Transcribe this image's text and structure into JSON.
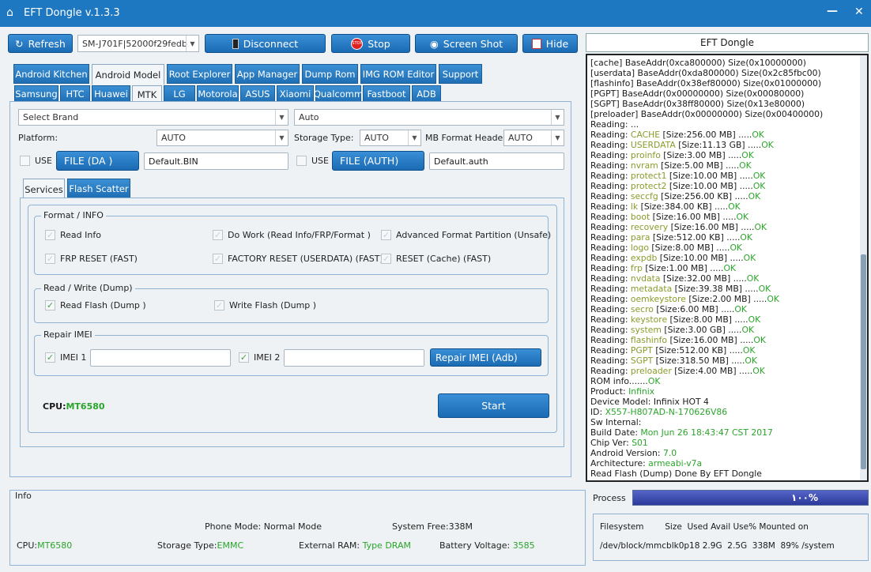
{
  "window": {
    "title": "EFT Dongle  v.1.3.3"
  },
  "toolbar": {
    "refresh": "Refresh",
    "device": "SM-J701F|52000f29fedb",
    "disconnect": "Disconnect",
    "stop": "Stop",
    "screenshot": "Screen Shot",
    "hide": "Hide"
  },
  "tabs_top": [
    "Android Kitchen",
    "Android Model",
    "Root Explorer",
    "App Manager",
    "Dump Rom",
    "IMG ROM Editor",
    "Support"
  ],
  "tabs_brand": [
    "Samsung",
    "HTC",
    "Huawei",
    "MTK",
    "LG",
    "Motorola",
    "ASUS",
    "Xiaomi",
    "Qualcomm",
    "Fastboot",
    "ADB"
  ],
  "form": {
    "brand": "Select Brand",
    "auto": "Auto",
    "platform_label": "Platform:",
    "platform": "AUTO",
    "storage_label": "Storage Type:",
    "storage": "AUTO",
    "mb_label": "MB Format Header",
    "mb": "AUTO",
    "use": "USE",
    "file_da": "FILE (DA )",
    "da_value": "Default.BIN",
    "file_auth": "FILE (AUTH)",
    "auth_value": "Default.auth"
  },
  "subtabs": [
    "Services",
    "Flash Scatter"
  ],
  "format_group": {
    "title": "Format / INFO",
    "read_info": "Read Info",
    "do_work": "Do Work (Read Info/FRP/Format )",
    "adv_format": "Advanced Format Partition (Unsafe)",
    "frp_reset": "FRP RESET (FAST)",
    "factory_reset": "FACTORY RESET (USERDATA) (FAST)",
    "reset_cache": "RESET (Cache) (FAST)"
  },
  "rw_group": {
    "title": "Read / Write (Dump)",
    "read_flash": "Read Flash (Dump )",
    "write_flash": "Write Flash (Dump )"
  },
  "imei_group": {
    "title": "Repair IMEI",
    "imei1": "IMEI 1",
    "imei2": "IMEI 2",
    "repair": "Repair IMEI (Adb)"
  },
  "cpu": {
    "label": "CPU:",
    "value": "MT6580"
  },
  "start": "Start",
  "log_title": "EFT Dongle",
  "log": [
    [
      [
        "[cache] BaseAddr(0xca800000) Size(0x10000000)",
        ""
      ]
    ],
    [
      [
        "[userdata] BaseAddr(0xda800000) Size(0x2c85fbc00)",
        ""
      ]
    ],
    [
      [
        "[flashinfo] BaseAddr(0x38ef80000) Size(0x01000000)",
        ""
      ]
    ],
    [
      [
        "[PGPT] BaseAddr(0x00000000) Size(0x00080000)",
        ""
      ]
    ],
    [
      [
        "[SGPT] BaseAddr(0x38ff80000) Size(0x13e80000)",
        ""
      ]
    ],
    [
      [
        "[preloader] BaseAddr(0x00000000) Size(0x00400000)",
        ""
      ]
    ],
    [
      [
        "Reading: ...",
        ""
      ]
    ],
    [
      [
        "Reading: ",
        ""
      ],
      [
        "CACHE",
        "y"
      ],
      [
        " [Size:256.00 MB] .....",
        ""
      ],
      [
        "OK",
        "g"
      ]
    ],
    [
      [
        "Reading: ",
        ""
      ],
      [
        "USERDATA",
        "y"
      ],
      [
        " [Size:11.13 GB] .....",
        ""
      ],
      [
        "OK",
        "g"
      ]
    ],
    [
      [
        "Reading: ",
        ""
      ],
      [
        "proinfo",
        "y"
      ],
      [
        " [Size:3.00 MB] .....",
        ""
      ],
      [
        "OK",
        "g"
      ]
    ],
    [
      [
        "Reading: ",
        ""
      ],
      [
        "nvram",
        "y"
      ],
      [
        " [Size:5.00 MB] .....",
        ""
      ],
      [
        "OK",
        "g"
      ]
    ],
    [
      [
        "Reading: ",
        ""
      ],
      [
        "protect1",
        "y"
      ],
      [
        " [Size:10.00 MB] .....",
        ""
      ],
      [
        "OK",
        "g"
      ]
    ],
    [
      [
        "Reading: ",
        ""
      ],
      [
        "protect2",
        "y"
      ],
      [
        " [Size:10.00 MB] .....",
        ""
      ],
      [
        "OK",
        "g"
      ]
    ],
    [
      [
        "Reading: ",
        ""
      ],
      [
        "seccfg",
        "y"
      ],
      [
        " [Size:256.00 KB] .....",
        ""
      ],
      [
        "OK",
        "g"
      ]
    ],
    [
      [
        "Reading: ",
        ""
      ],
      [
        "lk",
        "y"
      ],
      [
        " [Size:384.00 KB] .....",
        ""
      ],
      [
        "OK",
        "g"
      ]
    ],
    [
      [
        "Reading: ",
        ""
      ],
      [
        "boot",
        "y"
      ],
      [
        " [Size:16.00 MB] .....",
        ""
      ],
      [
        "OK",
        "g"
      ]
    ],
    [
      [
        "Reading: ",
        ""
      ],
      [
        "recovery",
        "y"
      ],
      [
        " [Size:16.00 MB] .....",
        ""
      ],
      [
        "OK",
        "g"
      ]
    ],
    [
      [
        "Reading: ",
        ""
      ],
      [
        "para",
        "y"
      ],
      [
        " [Size:512.00 KB] .....",
        ""
      ],
      [
        "OK",
        "g"
      ]
    ],
    [
      [
        "Reading: ",
        ""
      ],
      [
        "logo",
        "y"
      ],
      [
        " [Size:8.00 MB] .....",
        ""
      ],
      [
        "OK",
        "g"
      ]
    ],
    [
      [
        "Reading: ",
        ""
      ],
      [
        "expdb",
        "y"
      ],
      [
        " [Size:10.00 MB] .....",
        ""
      ],
      [
        "OK",
        "g"
      ]
    ],
    [
      [
        "Reading: ",
        ""
      ],
      [
        "frp",
        "y"
      ],
      [
        " [Size:1.00 MB] .....",
        ""
      ],
      [
        "OK",
        "g"
      ]
    ],
    [
      [
        "Reading: ",
        ""
      ],
      [
        "nvdata",
        "y"
      ],
      [
        " [Size:32.00 MB] .....",
        ""
      ],
      [
        "OK",
        "g"
      ]
    ],
    [
      [
        "Reading: ",
        ""
      ],
      [
        "metadata",
        "y"
      ],
      [
        " [Size:39.38 MB] .....",
        ""
      ],
      [
        "OK",
        "g"
      ]
    ],
    [
      [
        "Reading: ",
        ""
      ],
      [
        "oemkeystore",
        "y"
      ],
      [
        " [Size:2.00 MB] .....",
        ""
      ],
      [
        "OK",
        "g"
      ]
    ],
    [
      [
        "Reading: ",
        ""
      ],
      [
        "secro",
        "y"
      ],
      [
        " [Size:6.00 MB] .....",
        ""
      ],
      [
        "OK",
        "g"
      ]
    ],
    [
      [
        "Reading: ",
        ""
      ],
      [
        "keystore",
        "y"
      ],
      [
        " [Size:8.00 MB] .....",
        ""
      ],
      [
        "OK",
        "g"
      ]
    ],
    [
      [
        "Reading: ",
        ""
      ],
      [
        "system",
        "y"
      ],
      [
        " [Size:3.00 GB] .....",
        ""
      ],
      [
        "OK",
        "g"
      ]
    ],
    [
      [
        "Reading: ",
        ""
      ],
      [
        "flashinfo",
        "y"
      ],
      [
        " [Size:16.00 MB] .....",
        ""
      ],
      [
        "OK",
        "g"
      ]
    ],
    [
      [
        "Reading: ",
        ""
      ],
      [
        "PGPT",
        "y"
      ],
      [
        " [Size:512.00 KB] .....",
        ""
      ],
      [
        "OK",
        "g"
      ]
    ],
    [
      [
        "Reading: ",
        ""
      ],
      [
        "SGPT",
        "y"
      ],
      [
        " [Size:318.50 MB] .....",
        ""
      ],
      [
        "OK",
        "g"
      ]
    ],
    [
      [
        "Reading: ",
        ""
      ],
      [
        "preloader",
        "y"
      ],
      [
        " [Size:4.00 MB] .....",
        ""
      ],
      [
        "OK",
        "g"
      ]
    ],
    [
      [
        "ROM info.......",
        ""
      ],
      [
        "OK",
        "g"
      ]
    ],
    [
      [
        "Product: ",
        ""
      ],
      [
        "Infinix",
        "g"
      ]
    ],
    [
      [
        "Device Model: Infinix HOT 4",
        ""
      ]
    ],
    [
      [
        "ID: ",
        ""
      ],
      [
        "X557-H807AD-N-170626V86",
        "g"
      ]
    ],
    [
      [
        "Sw Internal:",
        ""
      ]
    ],
    [
      [
        "Build Date: ",
        ""
      ],
      [
        "Mon Jun 26 18:43:47 CST 2017",
        "g"
      ]
    ],
    [
      [
        "Chip Ver: ",
        ""
      ],
      [
        "S01",
        "g"
      ]
    ],
    [
      [
        "Android Version: ",
        ""
      ],
      [
        "7.0",
        "g"
      ]
    ],
    [
      [
        "Architecture: ",
        ""
      ],
      [
        "armeabi-v7a",
        "g"
      ]
    ],
    [
      [
        "Read Flash (Dump) Done By EFT Dongle",
        ""
      ]
    ]
  ],
  "process": {
    "label": "Process",
    "percent_text": "١٠٠%",
    "fraction": 1.0
  },
  "info": {
    "title": "Info",
    "phone_mode": "Phone Mode: Normal Mode",
    "system_free": "System Free:338M",
    "cpu_label": "CPU:",
    "cpu_value": "MT6580",
    "storage_label": "Storage Type:",
    "storage_value": "EMMC",
    "ram_label": "External RAM: ",
    "ram_value": "Type DRAM",
    "battery_label": "Battery Voltage: ",
    "battery_value": "3585"
  },
  "fs": {
    "header": "Filesystem        Size  Used Avail Use% Mounted on",
    "row": "/dev/block/mmcblk0p18 2.9G  2.5G  338M  89% /system"
  },
  "colors": {
    "accent": "#1d78c1",
    "ok_green": "#2aa52a",
    "partition": "#8a9a2a"
  }
}
